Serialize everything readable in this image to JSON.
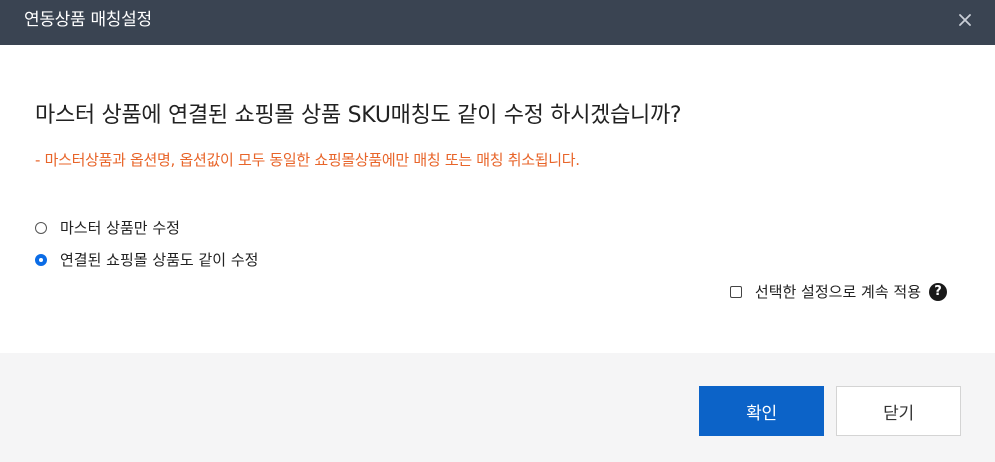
{
  "dialog": {
    "title": "연동상품 매칭설정",
    "close_icon": "close-icon"
  },
  "content": {
    "question": "마스터 상품에 연결된 쇼핑몰 상품 SKU매칭도 같이 수정 하시겠습니까?",
    "notice": "- 마스터상품과 옵션명, 옵션값이 모두 동일한 쇼핑몰상품에만 매칭 또는 매칭 취소됩니다.",
    "notice_color": "#e8652a",
    "options": [
      {
        "label": "마스터 상품만 수정",
        "checked": false
      },
      {
        "label": "연결된 쇼핑몰 상품도 같이 수정",
        "checked": true
      }
    ],
    "keep_setting_label": "선택한 설정으로 계속 적용",
    "keep_setting_checked": false,
    "help_icon": "question-circle-icon"
  },
  "footer": {
    "confirm_label": "확인",
    "close_label": "닫기",
    "confirm_color": "#0c63c8"
  }
}
